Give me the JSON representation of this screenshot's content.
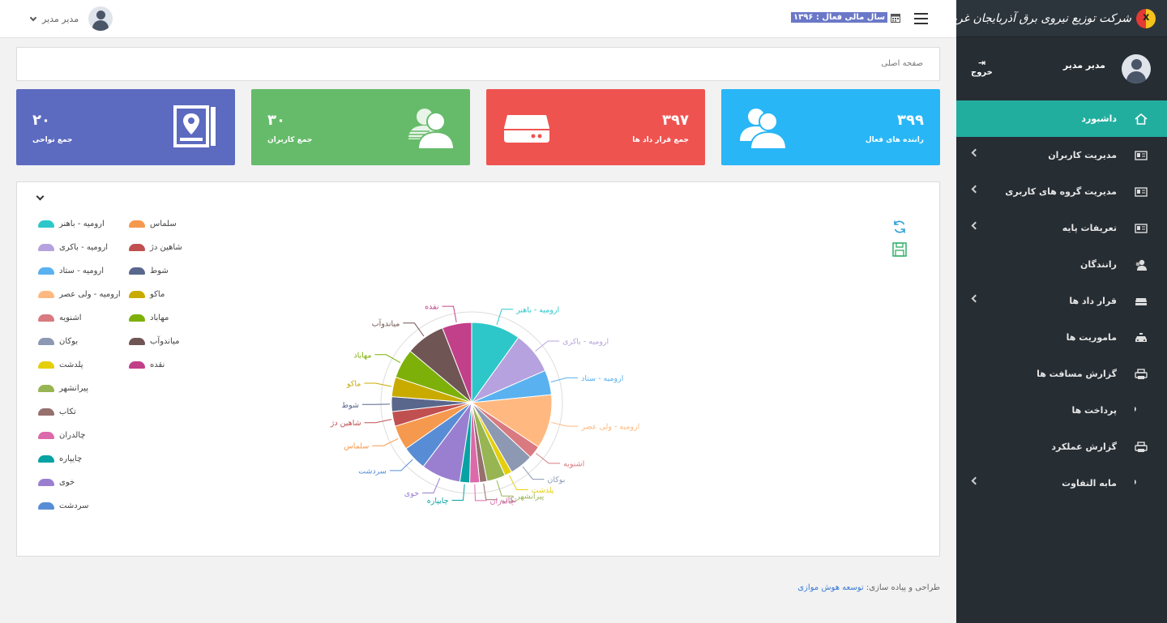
{
  "brand": {
    "name": "شرکت توزیع نیروی برق آذربایجان غربی"
  },
  "topbar": {
    "user_name": "مدیر مدیر",
    "fiscal_year": "سال مالی فعال : ۱۳۹۶"
  },
  "profile": {
    "name": "مدیر مدیر",
    "logout_label": "خروج"
  },
  "sidebar": {
    "items": [
      {
        "label": "داشبورد",
        "icon": "home-icon",
        "has_children": false,
        "active": true
      },
      {
        "label": "مدیریت کاربران",
        "icon": "id-card-icon",
        "has_children": true,
        "active": false
      },
      {
        "label": "مدیریت گروه های کاربری",
        "icon": "id-card-icon",
        "has_children": true,
        "active": false
      },
      {
        "label": "تعریفات پایه",
        "icon": "id-card-icon",
        "has_children": true,
        "active": false
      },
      {
        "label": "رانندگان",
        "icon": "user-icon",
        "has_children": false,
        "active": false
      },
      {
        "label": "قرار داد ها",
        "icon": "hdd-icon",
        "has_children": true,
        "active": false
      },
      {
        "label": "ماموریت ها",
        "icon": "taxi-icon",
        "has_children": false,
        "active": false
      },
      {
        "label": "گزارش مسافت ها",
        "icon": "print-icon",
        "has_children": false,
        "active": false
      },
      {
        "label": "پرداخت ها",
        "icon": "paypal-icon",
        "has_children": false,
        "active": false
      },
      {
        "label": "گزارش عملکرد",
        "icon": "print-icon",
        "has_children": false,
        "active": false
      },
      {
        "label": "مابه التفاوت",
        "icon": "paypal-icon",
        "has_children": true,
        "active": false
      }
    ]
  },
  "breadcrumb": {
    "label": "صفحه اصلی"
  },
  "cards": [
    {
      "value": "۳۹۹",
      "label": "راننده های فعال",
      "color": "#29b6f6",
      "icon": "users-icon"
    },
    {
      "value": "۳۹۷",
      "label": "جمع قرار داد ها",
      "color": "#ef5350",
      "icon": "hdd-icon"
    },
    {
      "value": "۳۰",
      "label": "جمع کاربران",
      "color": "#66bb6a",
      "icon": "users-icon"
    },
    {
      "value": "۲۰",
      "label": "جمع نواحی",
      "color": "#5c6bc0",
      "icon": "map-icon"
    }
  ],
  "chart_data": {
    "type": "pie",
    "title": "",
    "series": [
      {
        "name": "ارومیه - باهنر",
        "value": 10.0,
        "color": "#2ec7c9"
      },
      {
        "name": "ارومیه - باکری",
        "value": 8.6,
        "color": "#b6a2de"
      },
      {
        "name": "ارومیه - ستاد",
        "value": 5.0,
        "color": "#5ab1ef"
      },
      {
        "name": "ارومیه - ولی عصر",
        "value": 11.0,
        "color": "#ffb980"
      },
      {
        "name": "اشنویه",
        "value": 2.6,
        "color": "#d87a80"
      },
      {
        "name": "بوکان",
        "value": 4.8,
        "color": "#8d98b3"
      },
      {
        "name": "پلدشت",
        "value": 1.5,
        "color": "#e5cf0d"
      },
      {
        "name": "پیرانشهر",
        "value": 3.8,
        "color": "#97b552"
      },
      {
        "name": "تکاب",
        "value": 1.5,
        "color": "#95706d"
      },
      {
        "name": "چالدران",
        "value": 2.0,
        "color": "#dc69aa"
      },
      {
        "name": "چایپاره",
        "value": 2.0,
        "color": "#07a2a4"
      },
      {
        "name": "خوی",
        "value": 8.0,
        "color": "#9a7fd1"
      },
      {
        "name": "سردشت",
        "value": 5.0,
        "color": "#588dd5"
      },
      {
        "name": "سلماس",
        "value": 5.0,
        "color": "#f5994e"
      },
      {
        "name": "شاهین دژ",
        "value": 3.0,
        "color": "#c05050"
      },
      {
        "name": "شوط",
        "value": 3.0,
        "color": "#59678c"
      },
      {
        "name": "ماکو",
        "value": 4.0,
        "color": "#c9ab00"
      },
      {
        "name": "مهاباد",
        "value": 6.0,
        "color": "#7eb00a"
      },
      {
        "name": "میاندوآب",
        "value": 8.0,
        "color": "#6f5553"
      },
      {
        "name": "نقده",
        "value": 6.0,
        "color": "#c14089"
      }
    ]
  },
  "footer": {
    "prefix": "طراحی و پیاده سازی:",
    "link": "توسعه هوش موازی"
  }
}
